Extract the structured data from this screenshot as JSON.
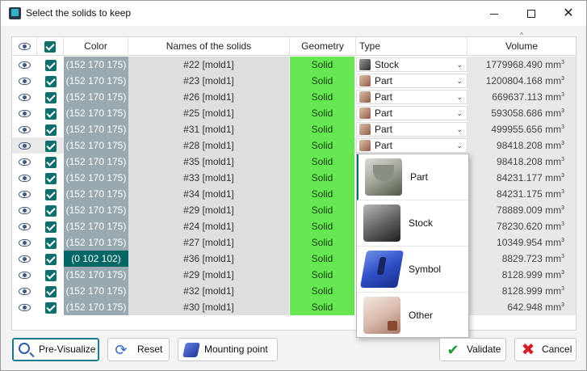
{
  "window": {
    "title": "Select the solids to keep"
  },
  "headers": {
    "visible": "",
    "keep": "",
    "color": "Color",
    "names": "Names of the solids",
    "geometry": "Geometry",
    "type": "Type",
    "volume": "Volume",
    "volume_sort_mark": "^"
  },
  "rows": [
    {
      "color": "(152 170 175)",
      "name": "#22 [mold1]",
      "geometry": "Solid",
      "type": "Stock",
      "volume": "1779968.490 mm",
      "selected": false
    },
    {
      "color": "(152 170 175)",
      "name": "#23 [mold1]",
      "geometry": "Solid",
      "type": "Part",
      "volume": "1200804.168 mm",
      "selected": false
    },
    {
      "color": "(152 170 175)",
      "name": "#26 [mold1]",
      "geometry": "Solid",
      "type": "Part",
      "volume": "669637.113 mm",
      "selected": false
    },
    {
      "color": "(152 170 175)",
      "name": "#25 [mold1]",
      "geometry": "Solid",
      "type": "Part",
      "volume": "593058.686 mm",
      "selected": false
    },
    {
      "color": "(152 170 175)",
      "name": "#31 [mold1]",
      "geometry": "Solid",
      "type": "Part",
      "volume": "499955.656 mm",
      "selected": false
    },
    {
      "color": "(152 170 175)",
      "name": "#28 [mold1]",
      "geometry": "Solid",
      "type": "Part",
      "volume": "98418.208 mm",
      "selected": true
    },
    {
      "color": "(152 170 175)",
      "name": "#35 [mold1]",
      "geometry": "Solid",
      "type": "",
      "volume": "98418.208 mm",
      "selected": false
    },
    {
      "color": "(152 170 175)",
      "name": "#33 [mold1]",
      "geometry": "Solid",
      "type": "",
      "volume": "84231.177 mm",
      "selected": false
    },
    {
      "color": "(152 170 175)",
      "name": "#34 [mold1]",
      "geometry": "Solid",
      "type": "",
      "volume": "84231.175 mm",
      "selected": false
    },
    {
      "color": "(152 170 175)",
      "name": "#29 [mold1]",
      "geometry": "Solid",
      "type": "",
      "volume": "78889.009 mm",
      "selected": false
    },
    {
      "color": "(152 170 175)",
      "name": "#24 [mold1]",
      "geometry": "Solid",
      "type": "",
      "volume": "78230.620 mm",
      "selected": false
    },
    {
      "color": "(152 170 175)",
      "name": "#27 [mold1]",
      "geometry": "Solid",
      "type": "",
      "volume": "10349.954 mm",
      "selected": false
    },
    {
      "color": "(0 102 102)",
      "name": "#36 [mold1]",
      "geometry": "Solid",
      "type": "",
      "volume": "8829.723 mm",
      "selected": false
    },
    {
      "color": "(152 170 175)",
      "name": "#29 [mold1]",
      "geometry": "Solid",
      "type": "",
      "volume": "8128.999 mm",
      "selected": false
    },
    {
      "color": "(152 170 175)",
      "name": "#32 [mold1]",
      "geometry": "Solid",
      "type": "",
      "volume": "8128.999 mm",
      "selected": false
    },
    {
      "color": "(152 170 175)",
      "name": "#30 [mold1]",
      "geometry": "Solid",
      "type": "",
      "volume": "642.948 mm",
      "selected": false
    }
  ],
  "volume_unit_exponent": "3",
  "row_colors": {
    "(152 170 175)": "#98aaaf",
    "(0 102 102)": "#006666"
  },
  "type_dropdown": {
    "options": [
      {
        "label": "Part",
        "icon": "part-icon"
      },
      {
        "label": "Stock",
        "icon": "stock-icon"
      },
      {
        "label": "Symbol",
        "icon": "symbol-icon"
      },
      {
        "label": "Other",
        "icon": "other-icon"
      }
    ],
    "highlighted": "Part"
  },
  "buttons": {
    "previsualize": "Pre-Visualize",
    "reset": "Reset",
    "mounting_point": "Mounting point",
    "validate": "Validate",
    "cancel": "Cancel"
  },
  "colors": {
    "geometry_solid": "#66e650",
    "checkbox": "#0f6f6d",
    "eye": "#3d5580"
  }
}
